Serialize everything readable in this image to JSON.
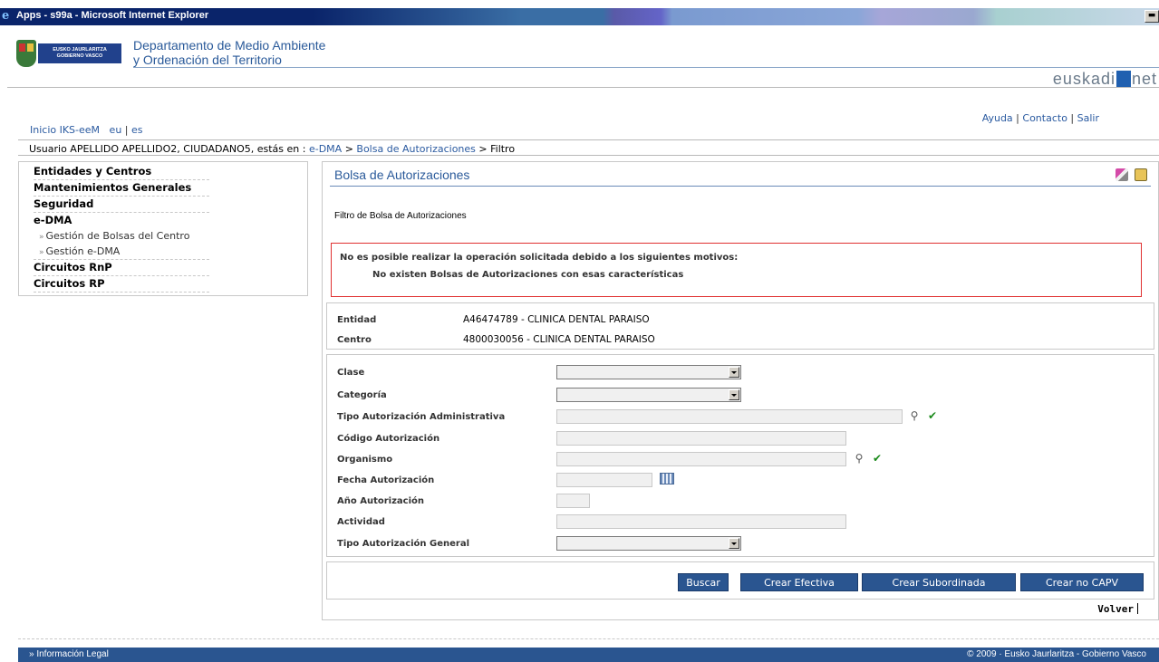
{
  "window": {
    "title": "Apps - s99a - Microsoft Internet Explorer",
    "min_label": "▬"
  },
  "header": {
    "logo_text": "EUSKO JAURLARITZA\nGOBIERNO VASCO",
    "dept_line1": "Departamento de Medio Ambiente",
    "dept_line2": "y Ordenación del Territorio",
    "brand_pre": "euskadi",
    "brand_post": "net"
  },
  "topnav": {
    "home": "Inicio IKS-eeM",
    "lang_eu": "eu",
    "sep": "|",
    "lang_es": "es"
  },
  "toplinks": {
    "ayuda": "Ayuda",
    "contacto": "Contacto",
    "salir": "Salir",
    "sep": "|"
  },
  "userline": {
    "prefix": "Usuario APELLIDO APELLIDO2, CIUDADANO5, estás en :",
    "crumb1": "e-DMA",
    "sep": ">",
    "crumb2": "Bolsa de Autorizaciones",
    "crumb3": "Filtro"
  },
  "sidebar": {
    "items": [
      {
        "label": "Entidades y Centros"
      },
      {
        "label": "Mantenimientos Generales"
      },
      {
        "label": "Seguridad"
      },
      {
        "label": "e-DMA"
      }
    ],
    "subitems": [
      {
        "label": "Gestión de Bolsas del Centro"
      },
      {
        "label": "Gestión e-DMA"
      }
    ],
    "items2": [
      {
        "label": "Circuitos RnP"
      },
      {
        "label": "Circuitos RP"
      }
    ]
  },
  "main": {
    "title": "Bolsa de Autorizaciones",
    "subtitle": "Filtro de Bolsa de Autorizaciones",
    "error_title": "No es posible realizar la operación solicitada debido a los siguientes motivos:",
    "error_reason": "No existen Bolsas de Autorizaciones con esas características",
    "entidad_label": "Entidad",
    "entidad_value": "A46474789 - CLINICA DENTAL PARAISO",
    "centro_label": "Centro",
    "centro_value": "4800030056 - CLINICA DENTAL PARAISO",
    "form": {
      "clase": "Clase",
      "categoria": "Categoría",
      "tipo_admin": "Tipo Autorización Administrativa",
      "codigo": "Código Autorización",
      "organismo": "Organismo",
      "fecha": "Fecha Autorización",
      "anio": "Año Autorización",
      "actividad": "Actividad",
      "tipo_general": "Tipo Autorización General"
    },
    "buttons": {
      "buscar": "Buscar",
      "crear_efectiva": "Crear Efectiva",
      "crear_subordinada": "Crear Subordinada",
      "crear_no_capv": "Crear no CAPV"
    },
    "volver": "Volver"
  },
  "footer": {
    "legal": "» Información Legal",
    "copyright": "© 2009 · Eusko Jaurlaritza - Gobierno Vasco"
  }
}
